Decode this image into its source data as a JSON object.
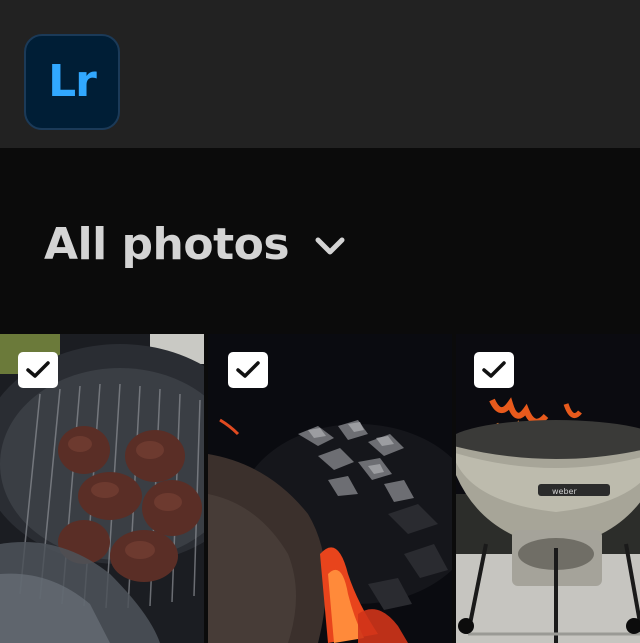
{
  "app": {
    "logo_text": "Lr",
    "logo_colors": {
      "background": "#001e36",
      "text": "#31a8ff"
    }
  },
  "album": {
    "title": "All photos",
    "chevron_icon": "chevron-down-icon"
  },
  "photos": [
    {
      "subject": "burger patties on grill",
      "selected": true,
      "check_icon": "checkmark-icon"
    },
    {
      "subject": "burning charcoal",
      "selected": true,
      "check_icon": "checkmark-icon"
    },
    {
      "subject": "kettle grill with flames",
      "selected": true,
      "check_icon": "checkmark-icon"
    }
  ],
  "colors": {
    "topbar": "#222222",
    "background": "#0b0b0b",
    "title_text": "#d4d4d4"
  }
}
